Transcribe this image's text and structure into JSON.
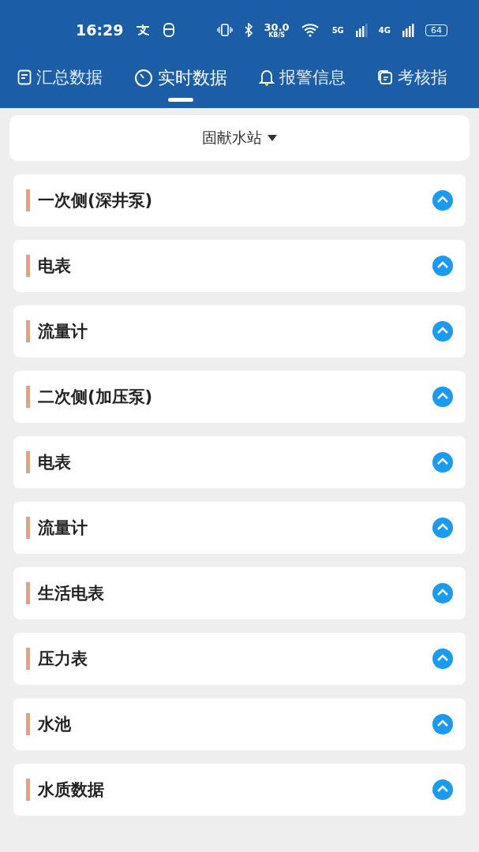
{
  "status_bar": {
    "time": "16:29",
    "speed": "30.0",
    "speed_unit": "KB/S",
    "sim1": "5G",
    "sim2": "4G",
    "battery": "64"
  },
  "tabs": [
    {
      "label": "汇总数据",
      "selected": false
    },
    {
      "label": "实时数据",
      "selected": true
    },
    {
      "label": "报警信息",
      "selected": false
    },
    {
      "label": "考核指",
      "selected": false
    }
  ],
  "station_select": {
    "value": "固献水站"
  },
  "sections": [
    {
      "title": "一次侧(深井泵)"
    },
    {
      "title": "电表"
    },
    {
      "title": "流量计"
    },
    {
      "title": "二次侧(加压泵)"
    },
    {
      "title": "电表"
    },
    {
      "title": "流量计"
    },
    {
      "title": "生活电表"
    },
    {
      "title": "压力表"
    },
    {
      "title": "水池"
    },
    {
      "title": "水质数据"
    }
  ]
}
